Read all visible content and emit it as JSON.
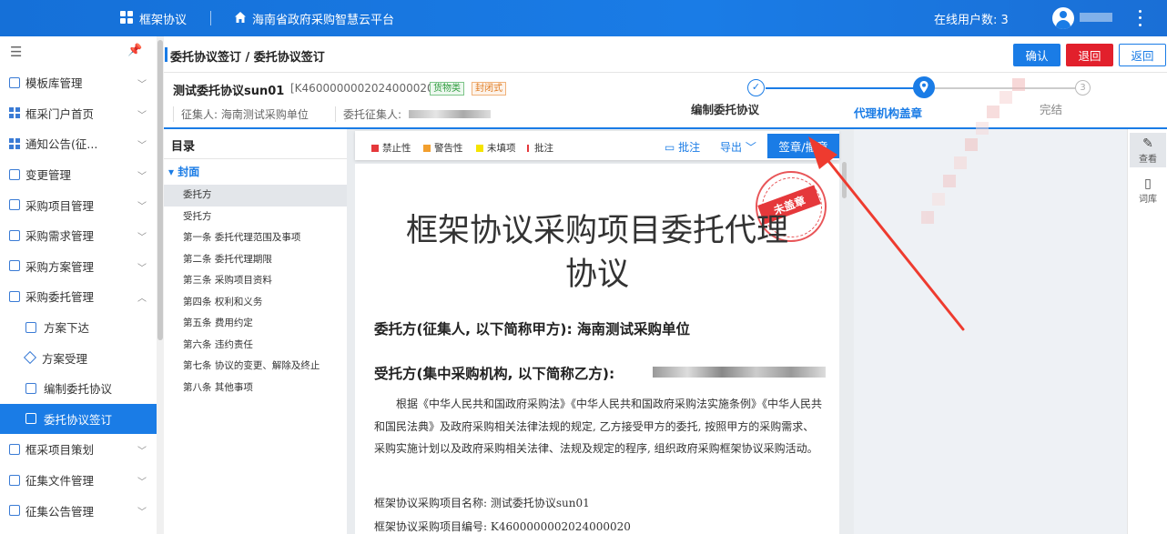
{
  "topbar": {
    "app_name": "框架协议",
    "platform_name": "海南省政府采购智慧云平台",
    "online_users": "在线用户数: 3",
    "colors": {
      "accent": "#1a7ce6"
    }
  },
  "sidebar": {
    "toggle_icon": "menu-icon",
    "pin_icon": "pin-icon",
    "items": [
      {
        "label": "模板库管理",
        "icon": "document-icon",
        "expanded": false
      },
      {
        "label": "框采门户首页",
        "icon": "grid-icon",
        "expanded": false
      },
      {
        "label": "通知公告(征...",
        "icon": "grid-icon",
        "expanded": false
      },
      {
        "label": "变更管理",
        "icon": "document-icon",
        "expanded": false
      },
      {
        "label": "采购项目管理",
        "icon": "folder-icon",
        "expanded": false
      },
      {
        "label": "采购需求管理",
        "icon": "document-icon",
        "expanded": false
      },
      {
        "label": "采购方案管理",
        "icon": "document-icon",
        "expanded": false
      },
      {
        "label": "采购委托管理",
        "icon": "document-icon",
        "expanded": true
      }
    ],
    "subitems": [
      {
        "label": "方案下达",
        "icon": "download-doc-icon"
      },
      {
        "label": "方案受理",
        "icon": "diamond-icon"
      },
      {
        "label": "编制委托协议",
        "icon": "edit-doc-icon"
      },
      {
        "label": "委托协议签订",
        "icon": "sign-doc-icon",
        "active": true
      }
    ],
    "after_items": [
      {
        "label": "框采项目策划",
        "icon": "folder-icon"
      },
      {
        "label": "征集文件管理",
        "icon": "document-icon"
      },
      {
        "label": "征集公告管理",
        "icon": "document-icon"
      }
    ]
  },
  "header": {
    "breadcrumb": "委托协议签订 / 委托协议签订",
    "confirm_label": "确认",
    "back_label": "退回",
    "return_label": "返回",
    "colors": {
      "confirm": "#1a7ce6",
      "back": "#e2202c"
    }
  },
  "project": {
    "title": "测试委托协议sun01",
    "code": "[K4600000002024000020]",
    "tag_goods": "货物类",
    "tag_closed": "封闭式",
    "collector_label": "征集人: 海南测试采购单位",
    "entrusted_label": "委托征集人:"
  },
  "steps": [
    {
      "label": "编制委托协议",
      "status": "done"
    },
    {
      "label": "代理机构盖章",
      "status": "current"
    },
    {
      "label": "完结",
      "status": "pending",
      "number": "3"
    }
  ],
  "toc": {
    "header": "目录",
    "section": "封面",
    "items": [
      "委托方",
      "受托方",
      "第一条 委托代理范围及事项",
      "第二条 委托代理期限",
      "第三条 采购项目资料",
      "第四条 权利和义务",
      "第五条 费用约定",
      "第六条 违约责任",
      "第七条 协议的变更、解除及终止",
      "第八条 其他事项"
    ],
    "active_index": 0
  },
  "doc_toolbar": {
    "legend": [
      {
        "label": "禁止性",
        "color": "#e5383b"
      },
      {
        "label": "警告性",
        "color": "#f29f2e"
      },
      {
        "label": "未填项",
        "color": "#f5e400"
      },
      {
        "label": "批注",
        "color": "#e5383b"
      }
    ],
    "annotate_label": "批注",
    "export_label": "导出",
    "sign_label": "签章/撤章"
  },
  "document": {
    "seal_label": "未盖章",
    "title_line1": "框架协议采购项目委托代理",
    "title_line2": "协议",
    "party_a": "委托方(征集人, 以下简称甲方):   海南测试采购单位",
    "party_b": "受托方(集中采购机构, 以下简称乙方):",
    "body": "根据《中华人民共和国政府采购法》《中华人民共和国政府采购法实施条例》《中华人民共和国民法典》及政府采购相关法律法规的规定, 乙方接受甲方的委托, 按照甲方的采购需求、采购实施计划以及政府采购相关法律、法规及规定的程序, 组织政府采购框架协议采购活动。",
    "project_name": "框架协议采购项目名称:  测试委托协议sun01",
    "project_code": "框架协议采购项目编号:  K4600000002024000020"
  },
  "right_tools": [
    {
      "label": "查看",
      "icon": "pen-icon"
    },
    {
      "label": "词库",
      "icon": "book-icon"
    }
  ]
}
